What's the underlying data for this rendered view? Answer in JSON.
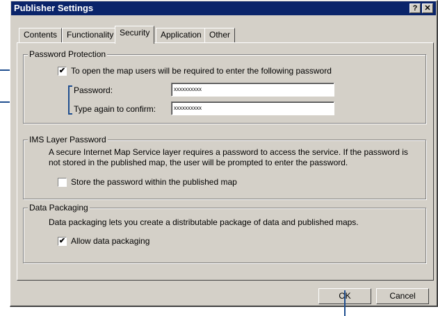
{
  "window": {
    "title": "Publisher Settings",
    "help_label": "?",
    "close_label": "✕"
  },
  "tabs": [
    {
      "label": "Contents",
      "active": false
    },
    {
      "label": "Functionality",
      "active": false
    },
    {
      "label": "Security",
      "active": true
    },
    {
      "label": "Application",
      "active": false
    },
    {
      "label": "Other",
      "active": false
    }
  ],
  "password_protection": {
    "legend": "Password Protection",
    "checkbox_label": "To open the map users will be required to enter the following password",
    "checked": true,
    "password_label": "Password:",
    "password_value": "xxxxxxxxxx",
    "confirm_label": "Type again to confirm:",
    "confirm_value": "xxxxxxxxxx"
  },
  "ims_layer": {
    "legend": "IMS Layer Password",
    "description_line1": "A secure Internet Map Service layer requires a password to access the service.  If the password is",
    "description_line2": "not stored in the published map, the user will be prompted to enter the password.",
    "checkbox_label": "Store the password within the published map",
    "checked": false
  },
  "data_packaging": {
    "legend": "Data Packaging",
    "description": "Data packaging lets you create a distributable package of data and published maps.",
    "checkbox_label": "Allow data packaging",
    "checked": true
  },
  "buttons": {
    "ok": "OK",
    "cancel": "Cancel"
  },
  "colors": {
    "titlebar": "#0a246a",
    "dialog": "#d4d0c8",
    "callout": "#1f4e8f"
  }
}
